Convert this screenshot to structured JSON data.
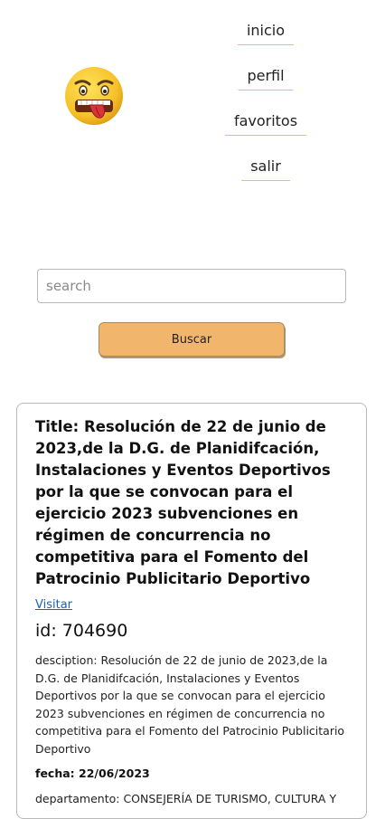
{
  "nav": {
    "items": [
      {
        "label": "inicio"
      },
      {
        "label": "perfil"
      },
      {
        "label": "favoritos"
      },
      {
        "label": "salir"
      }
    ],
    "accent_color": "#e3c07a"
  },
  "logo": {
    "icon": "grimacing-emoji-icon"
  },
  "search": {
    "placeholder": "search",
    "value": "",
    "button_label": "Buscar",
    "button_color": "#f1b66b"
  },
  "result": {
    "title": "Title: Resolución de 22 de junio de 2023,de la D.G. de Planidifcación, Instalaciones y Eventos Deportivos por la que se convocan para el ejercicio 2023 subvenciones en régimen de concurrencia no competitiva para el Fomento del Patrocinio Publicitario Deportivo",
    "link_label": "Visitar",
    "id_text": "id: 704690",
    "description": "desciption: Resolución de 22 de junio de 2023,de la D.G. de Planidifcación, Instalaciones y Eventos Deportivos por la que se convocan para el ejercicio 2023 subvenciones en régimen de concurrencia no competitiva para el Fomento del Patrocinio Publicitario Deportivo",
    "fecha": "fecha: 22/06/2023",
    "departamento": "departamento: CONSEJERÍA DE TURISMO, CULTURA Y"
  }
}
